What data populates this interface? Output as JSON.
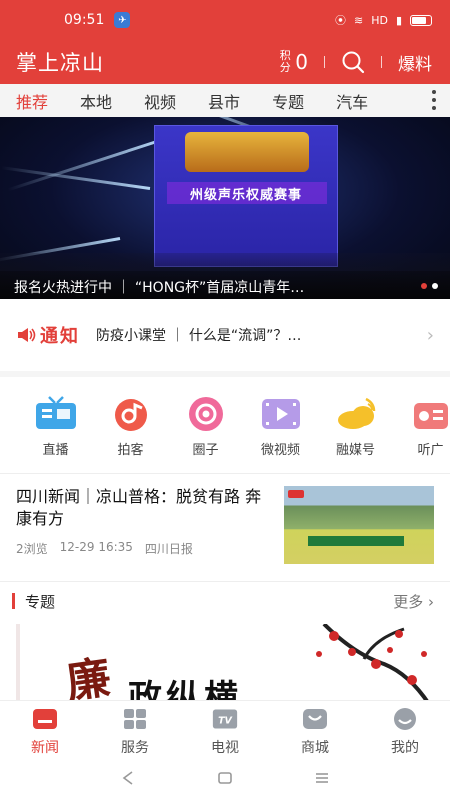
{
  "status_bar": {
    "time": "09:51",
    "network": "HD"
  },
  "header": {
    "title": "掌上凉山",
    "points_label": "积分",
    "points_value": "0",
    "baoliao_label": "爆料"
  },
  "tabs": [
    {
      "label": "推荐",
      "active": true
    },
    {
      "label": "本地"
    },
    {
      "label": "视频"
    },
    {
      "label": "县市"
    },
    {
      "label": "专题"
    },
    {
      "label": "汽车"
    }
  ],
  "banner": {
    "caption": "报名火热进行中 ｜ “HONG杯”首届凉山青年…",
    "screen_text": "州级声乐权威赛事"
  },
  "notice": {
    "label": "通知",
    "text": "防疫小课堂 ｜ 什么是“流调”？…"
  },
  "quick_links": [
    {
      "label": "直播",
      "icon": "tv-live-icon"
    },
    {
      "label": "拍客",
      "icon": "camera-music-icon"
    },
    {
      "label": "圈子",
      "icon": "circle-icon"
    },
    {
      "label": "微视频",
      "icon": "video-icon"
    },
    {
      "label": "融媒号",
      "icon": "cloud-icon"
    },
    {
      "label": "听广",
      "icon": "radio-icon"
    }
  ],
  "news": {
    "headline": "四川新闻｜凉山普格：脱贫有路 奔康有方",
    "views": "2浏览",
    "time": "12-29 16:35",
    "source": "四川日报"
  },
  "section": {
    "title": "专题",
    "more": "更多 ›"
  },
  "topic_banner": {
    "text_big": "廉",
    "text_main": "政纵横"
  },
  "bottom_nav": [
    {
      "label": "新闻",
      "active": true,
      "icon": "news-icon"
    },
    {
      "label": "服务",
      "icon": "grid-icon"
    },
    {
      "label": "电视",
      "icon": "tv-icon"
    },
    {
      "label": "商城",
      "icon": "shop-icon"
    },
    {
      "label": "我的",
      "icon": "profile-icon"
    }
  ],
  "colors": {
    "brand": "#e2403a",
    "tab_bg": "#f4f4f4"
  }
}
